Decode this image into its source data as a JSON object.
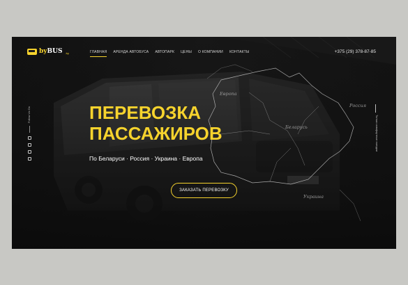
{
  "logo": {
    "brand_y": "by",
    "brand_w": "BUS",
    "domain": ".by"
  },
  "nav": {
    "items": [
      {
        "label": "ГЛАВНАЯ",
        "active": true
      },
      {
        "label": "АРЕНДА АВТОБУСА",
        "active": false
      },
      {
        "label": "АВТОПАРК",
        "active": false
      },
      {
        "label": "ЦЕНЫ",
        "active": false
      },
      {
        "label": "О КОМПАНИИ",
        "active": false
      },
      {
        "label": "КОНТАКТЫ",
        "active": false
      }
    ]
  },
  "header": {
    "phone": "+375 (29) 378-87-85"
  },
  "hero": {
    "title_line1": "ПЕРЕВОЗКА",
    "title_line2": "ПАССАЖИРОВ",
    "subtitle": "По Беларуси · Россия · Украина · Европа",
    "cta_label": "ЗАКАЗАТЬ ПЕРЕВОЗКУ"
  },
  "side_left": {
    "vertical_text": "Follow Us On"
  },
  "side_right": {
    "vertical_text": "Только комфортные поездки"
  },
  "map": {
    "labels": {
      "europe": "Европа",
      "russia": "Россия",
      "belarus": "Беларусь",
      "ukraine": "Украина"
    }
  },
  "colors": {
    "accent": "#f6d32d",
    "background": "#1b1b1b",
    "outer": "#c8c8c4"
  },
  "icons": [
    "bus-logo-icon",
    "vk-icon",
    "twitter-icon",
    "instagram-icon",
    "odnoklassniki-icon"
  ]
}
